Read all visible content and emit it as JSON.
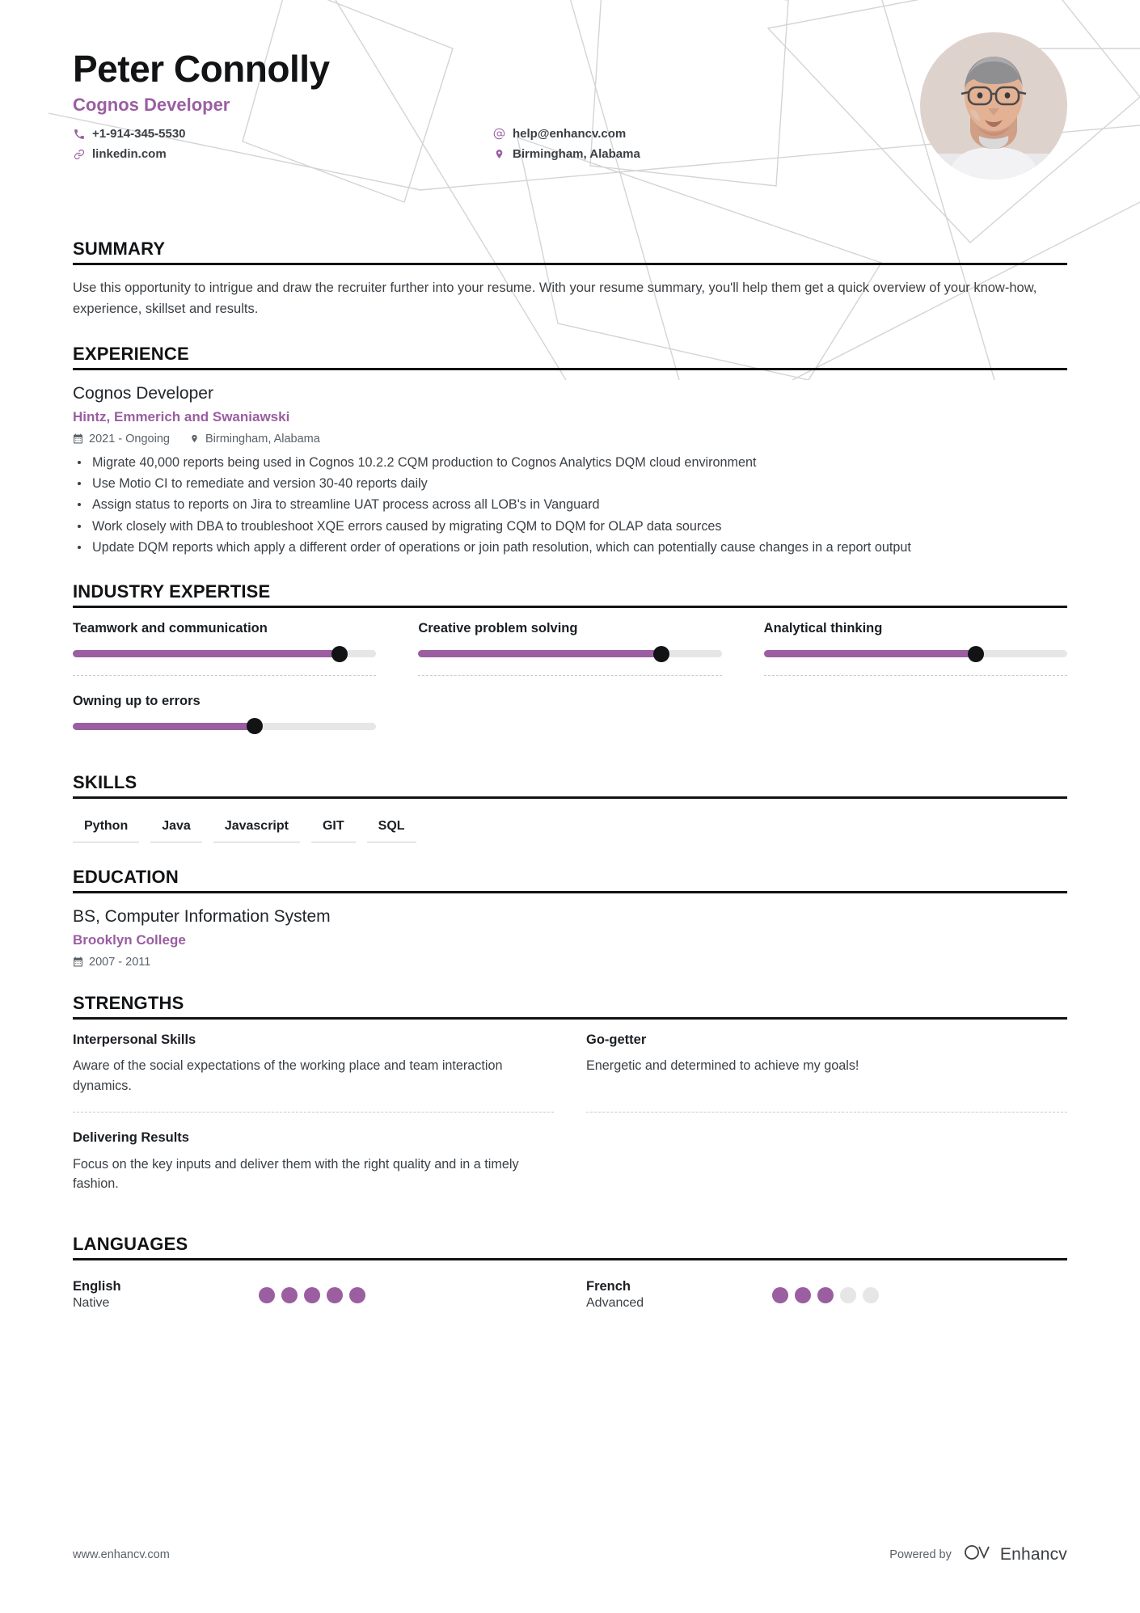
{
  "theme": {
    "accent": "#9a5ea1",
    "text_dark": "#1b1f24",
    "text_body": "#3b4045",
    "muted": "#5a6169",
    "track": "#e6e6e6"
  },
  "header": {
    "name": "Peter Connolly",
    "job_title": "Cognos Developer",
    "contacts_left": [
      {
        "icon": "phone-icon",
        "text": "+1-914-345-5530"
      },
      {
        "icon": "link-icon",
        "text": "linkedin.com"
      }
    ],
    "contacts_right": [
      {
        "icon": "at-email-icon",
        "text": "help@enhancv.com"
      },
      {
        "icon": "location-pin-icon",
        "text": "Birmingham, Alabama"
      }
    ]
  },
  "summary": {
    "title": "SUMMARY",
    "text": "Use this opportunity to intrigue and draw the recruiter further into your resume. With your resume summary, you'll help them get a quick overview of your know-how, experience, skillset and results."
  },
  "experience": {
    "title": "EXPERIENCE",
    "entries": [
      {
        "role": "Cognos Developer",
        "company": "Hintz, Emmerich and Swaniawski",
        "dates": "2021 - Ongoing",
        "location": "Birmingham, Alabama",
        "bullets": [
          "Migrate 40,000 reports being used in Cognos 10.2.2 CQM production to Cognos Analytics DQM cloud environment",
          "Use Motio CI to remediate and version 30-40 reports daily",
          "Assign status to reports on Jira to streamline UAT process across all LOB's in Vanguard",
          "Work closely with DBA to troubleshoot XQE errors caused by migrating CQM to DQM for OLAP data sources",
          "Update DQM reports which apply a different order of operations or join path resolution, which can potentially cause changes in a report output"
        ]
      }
    ]
  },
  "industry_expertise": {
    "title": "INDUSTRY EXPERTISE",
    "items": [
      {
        "label": "Teamwork and communication",
        "value": 88
      },
      {
        "label": "Creative problem solving",
        "value": 80
      },
      {
        "label": "Analytical thinking",
        "value": 70
      },
      {
        "label": "Owning up to errors",
        "value": 60
      }
    ]
  },
  "skills": {
    "title": "SKILLS",
    "items": [
      "Python",
      "Java",
      "Javascript",
      "GIT",
      "SQL"
    ]
  },
  "education": {
    "title": "EDUCATION",
    "entries": [
      {
        "degree": "BS, Computer Information System",
        "school": "Brooklyn College",
        "dates": "2007 - 2011"
      }
    ]
  },
  "strengths": {
    "title": "STRENGTHS",
    "items": [
      {
        "title": "Interpersonal Skills",
        "description": "Aware of the social expectations of the working place and team interaction dynamics."
      },
      {
        "title": "Go-getter",
        "description": "Energetic and determined to achieve my goals!"
      },
      {
        "title": "Delivering Results",
        "description": "Focus on the key inputs and deliver them with the right quality and in a timely fashion."
      }
    ]
  },
  "languages": {
    "title": "LANGUAGES",
    "items": [
      {
        "name": "English",
        "level": "Native",
        "filled": 5,
        "total": 5
      },
      {
        "name": "French",
        "level": "Advanced",
        "filled": 3,
        "total": 5
      }
    ]
  },
  "footer": {
    "url": "www.enhancv.com",
    "powered_by": "Powered by",
    "brand": "Enhancv"
  }
}
